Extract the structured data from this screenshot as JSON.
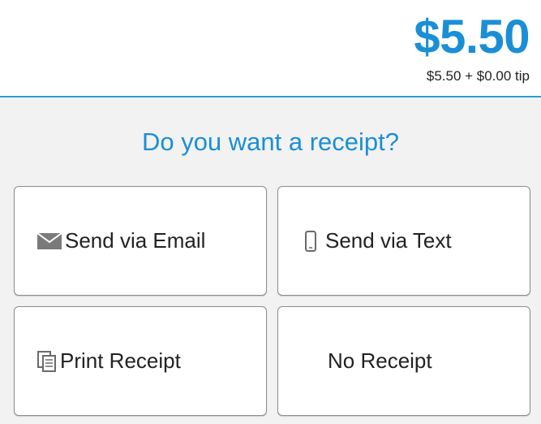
{
  "header": {
    "total": "$5.50",
    "breakdown": "$5.50 + $0.00 tip"
  },
  "prompt": {
    "question": "Do you want a receipt?"
  },
  "options": {
    "email": {
      "label": "Send via Email",
      "icon": "envelope-icon"
    },
    "text": {
      "label": "Send via Text",
      "icon": "phone-icon"
    },
    "print": {
      "label": "Print Receipt",
      "icon": "document-copy-icon"
    },
    "none": {
      "label": "No Receipt"
    }
  },
  "colors": {
    "accent": "#1a8fd6",
    "divider": "#2a9fd9",
    "background": "#f2f2f2"
  }
}
